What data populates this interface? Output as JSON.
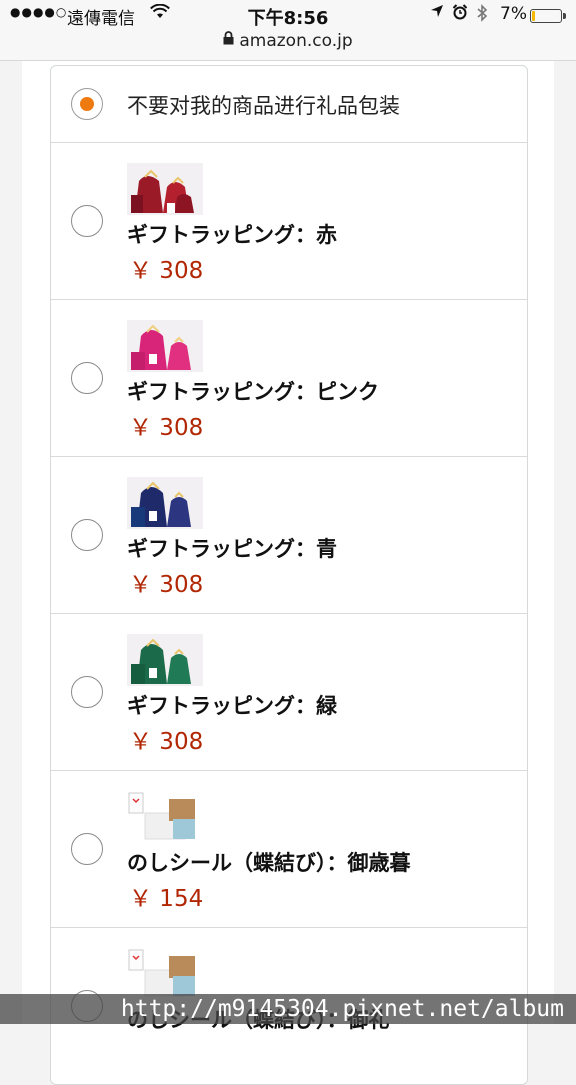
{
  "status_bar": {
    "carrier": "遠傳電信",
    "time": "下午8:56",
    "battery_percent": "7%",
    "url": "amazon.co.jp"
  },
  "gift_options": [
    {
      "label": "不要对我的商品进行礼品包装",
      "selected": true
    },
    {
      "name": "ギフトラッピング：赤",
      "price": "￥ 308",
      "selected": false,
      "icon": "gift-bag-red",
      "color": "#a0182a"
    },
    {
      "name": "ギフトラッピング：ピンク",
      "price": "￥ 308",
      "selected": false,
      "icon": "gift-bag-pink",
      "color": "#d8257a"
    },
    {
      "name": "ギフトラッピング：青",
      "price": "￥ 308",
      "selected": false,
      "icon": "gift-bag-blue",
      "color": "#1f2a6b"
    },
    {
      "name": "ギフトラッピング：緑",
      "price": "￥ 308",
      "selected": false,
      "icon": "gift-bag-green",
      "color": "#1b6b4a"
    },
    {
      "name": "のしシール（蝶結び）：御歳暮",
      "price": "￥ 154",
      "selected": false,
      "icon": "noshi-seal"
    },
    {
      "name": "のしシール（蝶結び）：御礼",
      "selected": false,
      "icon": "noshi-seal"
    }
  ],
  "watermark": "http://m9145304.pixnet.net/album"
}
